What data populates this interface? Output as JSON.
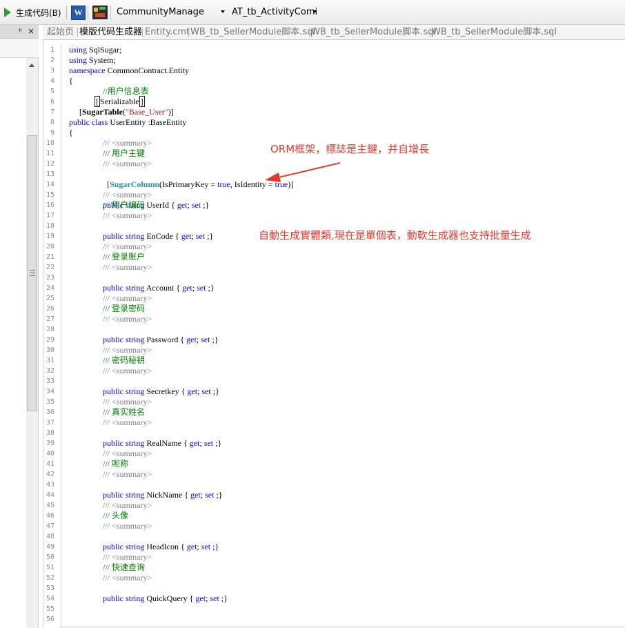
{
  "toolbar": {
    "generate_label": "生成代码(B)",
    "word_icon_letter": "W",
    "database_value": "CommunityManage",
    "table_value": "AT_tb_ActivityComi"
  },
  "left_panel": {
    "pin_glyph": "ᵖ",
    "close_glyph": "×"
  },
  "tabs": [
    {
      "label": "起始页",
      "active": false
    },
    {
      "label": "模版代码生成器",
      "active": true
    },
    {
      "label": "Entity.cmt",
      "active": false
    },
    {
      "label": "WB_tb_SellerModule脚本.sql",
      "active": false
    },
    {
      "label": "WB_tb_SellerModule脚本.sql",
      "active": false
    },
    {
      "label": "WB_tb_SellerModule脚本.sql",
      "active": false
    }
  ],
  "code": {
    "using1": "using",
    "using1_ns": " SqlSugar;",
    "using2": "using",
    "using2_ns": " System;",
    "namespace_kw": "namespace",
    "namespace_name": " CommonContract.Entity",
    "brace_open": "{",
    "comment_class": "//用户信息表",
    "serializable": "Serializable",
    "sugartable_attr": "SugarTable",
    "sugartable_arg": "\"Base_User\"",
    "public_kw": "public",
    "class_kw": " class",
    "class_decl": " UserEntity :BaseEntity",
    "doc_prefix": "///",
    "summary_open": " <summary>",
    "summary_close": " <summary>",
    "sugarcolumn_attr": "SugarColumn",
    "sugarcolumn_p1": "(IsPrimaryKey = ",
    "true_kw": "true",
    "sugarcolumn_p2": ", IsIdentity = ",
    "sugarcolumn_end": ")]",
    "get_kw": "get",
    "set_kw": "set",
    "properties": [
      {
        "comment": " 用户主键",
        "name": "UserId"
      },
      {
        "comment": " 用户编码",
        "name": "EnCode"
      },
      {
        "comment": " 登录账户",
        "name": "Account"
      },
      {
        "comment": " 登录密码",
        "name": "Password"
      },
      {
        "comment": " 密码秘钥",
        "name": "Secretkey"
      },
      {
        "comment": " 真实姓名",
        "name": "RealName"
      },
      {
        "comment": " 呢称",
        "name": "NickName"
      },
      {
        "comment": " 头像",
        "name": "HeadIcon"
      },
      {
        "comment": " 快速查询",
        "name": "QuickQuery"
      }
    ]
  },
  "annotations": {
    "note1": "ORM框架，標誌是主鍵，并自增長",
    "note2": "自動生成實體類,現在是單個表，動軟生成器也支持批量生成"
  },
  "colors": {
    "annotation": "#e33a2c",
    "keyword": "#0000ee",
    "comment": "#008000"
  }
}
